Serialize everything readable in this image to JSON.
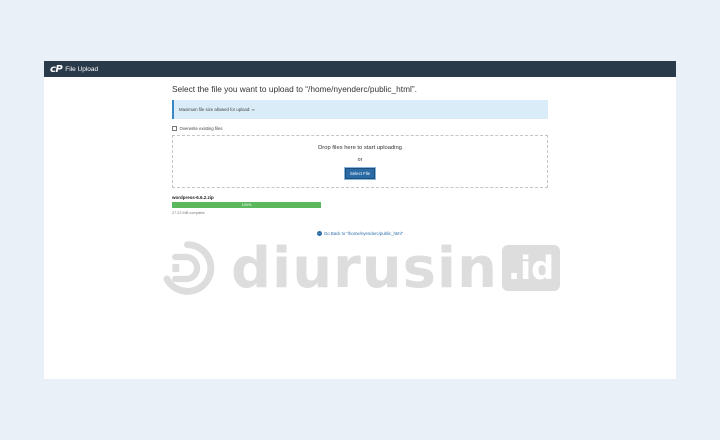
{
  "topbar": {
    "logo": "cP",
    "title": "File Upload"
  },
  "main": {
    "heading": "Select the file you want to upload to “/home/nyenderc/public_html”.",
    "info_text": "Maximum file size allowed for upload: ∞",
    "overwrite_label": "Overwrite existing files",
    "overwrite_checked": false,
    "dropzone_text": "Drop files here to start uploading",
    "or_text": "or",
    "select_button": "Select File",
    "upload": {
      "file_name": "wordpress-6.6.2.zip",
      "progress_label": "100%",
      "progress_percent": 100,
      "size_text": "27.22 MB complete"
    },
    "go_back_text": "Go Back to “/home/nyenderc/public_html”"
  },
  "watermark": {
    "text": "diurusin",
    "badge": ".id"
  },
  "colors": {
    "topbar": "#293a4a",
    "info_bg": "#d9ecf7",
    "button": "#2a6ba6",
    "progress": "#5cb85c",
    "watermark": "#b4b4b4"
  }
}
